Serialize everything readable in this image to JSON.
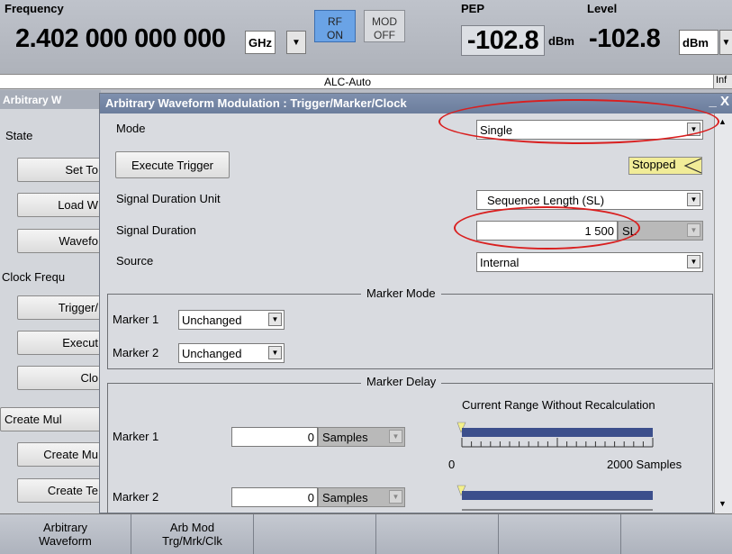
{
  "header": {
    "frequency_label": "Frequency",
    "frequency_value": "2.402 000 000 000",
    "frequency_unit": "GHz",
    "rf_label": "RF",
    "rf_state": "ON",
    "mod_label": "MOD",
    "mod_state": "OFF",
    "pep_label": "PEP",
    "pep_value": "-102.8",
    "pep_unit": "dBm",
    "level_label": "Level",
    "level_value": "-102.8",
    "level_unit": "dBm",
    "alc_status": "ALC-Auto",
    "info_label": "Inf"
  },
  "background_panel": {
    "title": "Arbitrary W",
    "state_label": "State",
    "set_button": "Set To",
    "load_button": "Load W",
    "waveform_button": "Wavefo",
    "clock_label": "Clock Frequ",
    "trigger_button": "Trigger/",
    "execute_button": "Execut",
    "clock_button": "Clo",
    "create_multi_button": "Create Mul",
    "create_m_button": "Create Mu",
    "create_te_button": "Create Te"
  },
  "dialog": {
    "title": "Arbitrary Waveform Modulation : Trigger/Marker/Clock",
    "close_glyph": "_ X",
    "mode_label": "Mode",
    "mode_value": "Single",
    "execute_trigger_button": "Execute Trigger",
    "trigger_status": "Stopped",
    "signal_duration_unit_label": "Signal Duration Unit",
    "signal_duration_unit_value": "Sequence Length (SL)",
    "signal_duration_label": "Signal Duration",
    "signal_duration_value": "1 500",
    "signal_duration_unit": "SL",
    "source_label": "Source",
    "source_value": "Internal",
    "marker_mode": {
      "title": "Marker Mode",
      "marker1_label": "Marker 1",
      "marker1_value": "Unchanged",
      "marker2_label": "Marker 2",
      "marker2_value": "Unchanged"
    },
    "marker_delay": {
      "title": "Marker Delay",
      "range_title": "Current Range Without Recalculation",
      "marker1_label": "Marker 1",
      "marker1_value": "0",
      "marker1_unit": "Samples",
      "marker2_label": "Marker 2",
      "marker2_value": "0",
      "marker2_unit": "Samples",
      "scale_min": "0",
      "scale_max": "2000 Samples"
    }
  },
  "softkeys": [
    {
      "line1": "Arbitrary",
      "line2": "Waveform"
    },
    {
      "line1": "Arb Mod",
      "line2": "Trg/Mrk/Clk"
    },
    {
      "line1": "",
      "line2": ""
    },
    {
      "line1": "",
      "line2": ""
    },
    {
      "line1": "",
      "line2": ""
    },
    {
      "line1": "",
      "line2": ""
    }
  ],
  "colors": {
    "rf_on": "#6aa3e6",
    "title_bar": "#7486a5",
    "annotation_ellipse": "#d91f1f",
    "slider_bar": "#3c4f8c",
    "slider_marker": "#f4f08a"
  }
}
